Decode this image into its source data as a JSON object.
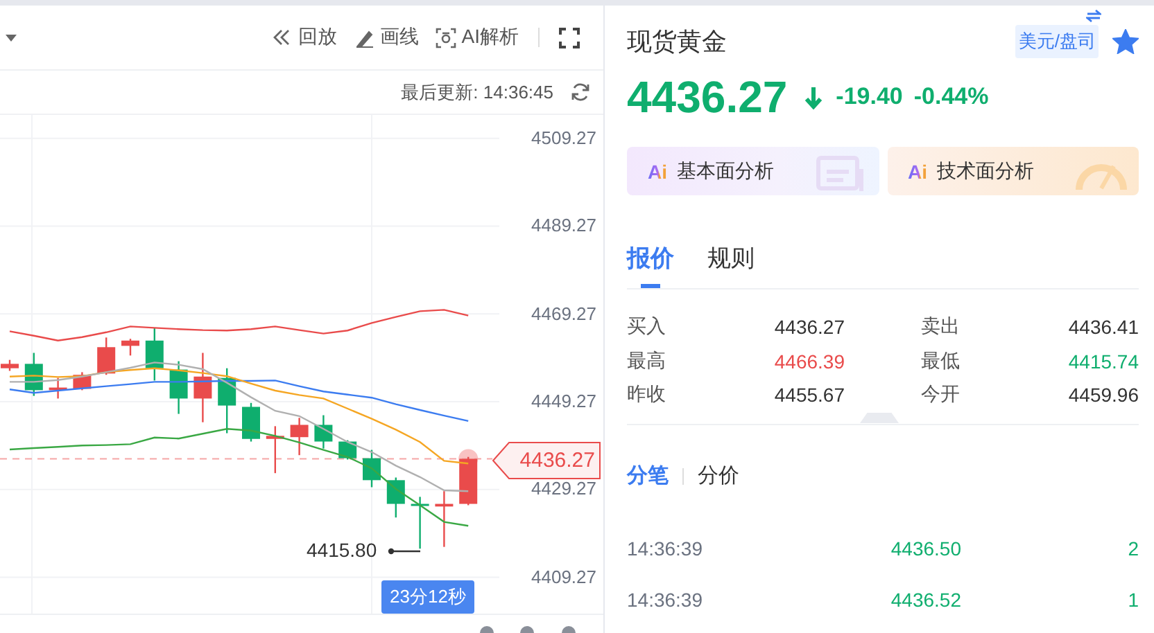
{
  "chart_panel": {
    "toolbar": [
      {
        "kind": "replay",
        "label": "回放"
      },
      {
        "kind": "draw",
        "label": "画线"
      },
      {
        "kind": "ai",
        "label": "AI解析"
      }
    ],
    "last_update": "最后更新: 14:36:45",
    "chart_data": {
      "type": "candlestick",
      "grid": true,
      "ylim": [
        4401.0,
        4514.6
      ],
      "ohlc": [
        [
          4456.9,
          4458.8,
          4456.3,
          4457.9
        ],
        [
          4457.9,
          4460.4,
          4450.6,
          4451.9
        ],
        [
          4451.9,
          4454.7,
          4450.0,
          4452.5
        ],
        [
          4452.2,
          4456.0,
          4451.9,
          4455.4
        ],
        [
          4455.7,
          4463.9,
          4455.4,
          4461.7
        ],
        [
          4462.0,
          4463.6,
          4459.8,
          4463.2
        ],
        [
          4463.2,
          4466.1,
          4454.1,
          4456.9
        ],
        [
          4456.6,
          4458.5,
          4446.5,
          4450.0
        ],
        [
          4450.0,
          4460.4,
          4444.6,
          4455.0
        ],
        [
          4454.7,
          4456.9,
          4442.1,
          4448.4
        ],
        [
          4448.1,
          4449.0,
          4440.2,
          4440.8
        ],
        [
          4440.8,
          4443.7,
          4433.0,
          4441.5
        ],
        [
          4441.2,
          4445.6,
          4437.1,
          4444.0
        ],
        [
          4444.0,
          4446.2,
          4438.6,
          4440.2
        ],
        [
          4440.2,
          4440.5,
          4436.1,
          4436.4
        ],
        [
          4436.4,
          4438.3,
          4429.8,
          4431.4
        ],
        [
          4431.4,
          4432.0,
          4422.9,
          4426.0
        ],
        [
          4426.0,
          4427.6,
          4415.8,
          4425.7
        ],
        [
          4425.4,
          4428.9,
          4416.2,
          4426.0
        ],
        [
          4426.0,
          4436.7,
          4425.7,
          4436.27
        ]
      ],
      "ref_lines": [
        {
          "axis": "y",
          "value": 4436.27,
          "color": "#f5a5a5"
        }
      ],
      "yticks": [
        {
          "value": 4509.27,
          "label": "4509.27"
        },
        {
          "value": 4489.27,
          "label": "4489.27"
        },
        {
          "value": 4469.27,
          "label": "4469.27"
        },
        {
          "value": 4449.27,
          "label": "4449.27"
        },
        {
          "value": 4429.27,
          "label": "4429.27"
        },
        {
          "value": 4409.27,
          "label": "4409.27"
        }
      ],
      "series": [
        {
          "type": "line",
          "color": "#e94b4b",
          "values": [
            4465.3,
            4464.3,
            4463.2,
            4464.0,
            4465.1,
            4466.4,
            4466.1,
            4465.8,
            4465.6,
            4465.5,
            4465.8,
            4466.4,
            4465.6,
            4464.8,
            4465.5,
            4467.2,
            4468.6,
            4469.9,
            4470.2,
            4468.9
          ]
        },
        {
          "type": "line",
          "color": "#3c7cf0",
          "values": [
            4452.1,
            4451.3,
            4451.8,
            4452.3,
            4452.8,
            4453.3,
            4453.8,
            4453.8,
            4453.9,
            4454.0,
            4454.0,
            4454.1,
            4452.8,
            4451.6,
            4450.9,
            4450.2,
            4448.7,
            4447.4,
            4446.1,
            4444.9
          ]
        },
        {
          "type": "line",
          "color": "#f5a623",
          "values": [
            4455.0,
            4455.2,
            4454.9,
            4455.1,
            4456.0,
            4456.5,
            4456.9,
            4456.4,
            4455.8,
            4455.1,
            4453.4,
            4451.8,
            4450.8,
            4450.0,
            4447.7,
            4445.4,
            4442.9,
            4440.1,
            4435.8,
            4435.2
          ]
        },
        {
          "type": "line",
          "color": "#b0b0b0",
          "values": [
            4453.8,
            4453.8,
            4454.2,
            4455.0,
            4456.0,
            4457.0,
            4458.2,
            4457.7,
            4456.7,
            4453.6,
            4450.3,
            4447.2,
            4446.0,
            4443.1,
            4440.1,
            4437.8,
            4434.7,
            4432.1,
            4429.1,
            4428.9
          ]
        },
        {
          "type": "line",
          "color": "#3aa844",
          "values": [
            4438.4,
            4438.7,
            4439.0,
            4439.3,
            4439.4,
            4439.6,
            4441.1,
            4440.9,
            4442.0,
            4443.1,
            4442.7,
            4441.5,
            4440.0,
            4438.3,
            4436.7,
            4434.1,
            4429.4,
            4425.7,
            4421.9,
            4421.0
          ]
        }
      ]
    },
    "current_price_tag": "4436.27",
    "low_marker": "4415.80",
    "countdown": "23分12秒"
  },
  "quote_panel": {
    "title": "现货黄金",
    "unit": "美元/盘司",
    "favorited": true,
    "price": "4436.27",
    "falling": true,
    "change": "-19.40",
    "change_percent": "-0.44%",
    "ai_cards": [
      {
        "kind": "fundamental",
        "logo": "Ai",
        "label": "基本面分析"
      },
      {
        "kind": "technical",
        "logo": "Ai",
        "label": "技术面分析"
      }
    ],
    "tabs": [
      {
        "label": "报价",
        "selected": true
      },
      {
        "label": "规则",
        "selected": false
      }
    ],
    "quotes": [
      {
        "label": "买入",
        "value": "4436.27",
        "color": "#333333"
      },
      {
        "label": "卖出",
        "value": "4436.41",
        "color": "#333333"
      },
      {
        "label": "最高",
        "value": "4466.39",
        "color": "#e94b4b"
      },
      {
        "label": "最低",
        "value": "4415.74",
        "color": "#0fae6e"
      },
      {
        "label": "昨收",
        "value": "4455.67",
        "color": "#333333"
      },
      {
        "label": "今开",
        "value": "4459.96",
        "color": "#333333"
      }
    ],
    "sub_tabs": [
      {
        "label": "分笔",
        "selected": true
      },
      {
        "label": "分价",
        "selected": false
      }
    ],
    "trades": [
      {
        "time": "14:36:39",
        "price": "4436.50",
        "volume": "2",
        "color": "#0fae6e"
      },
      {
        "time": "14:36:39",
        "price": "4436.52",
        "volume": "1",
        "color": "#0fae6e"
      }
    ]
  }
}
